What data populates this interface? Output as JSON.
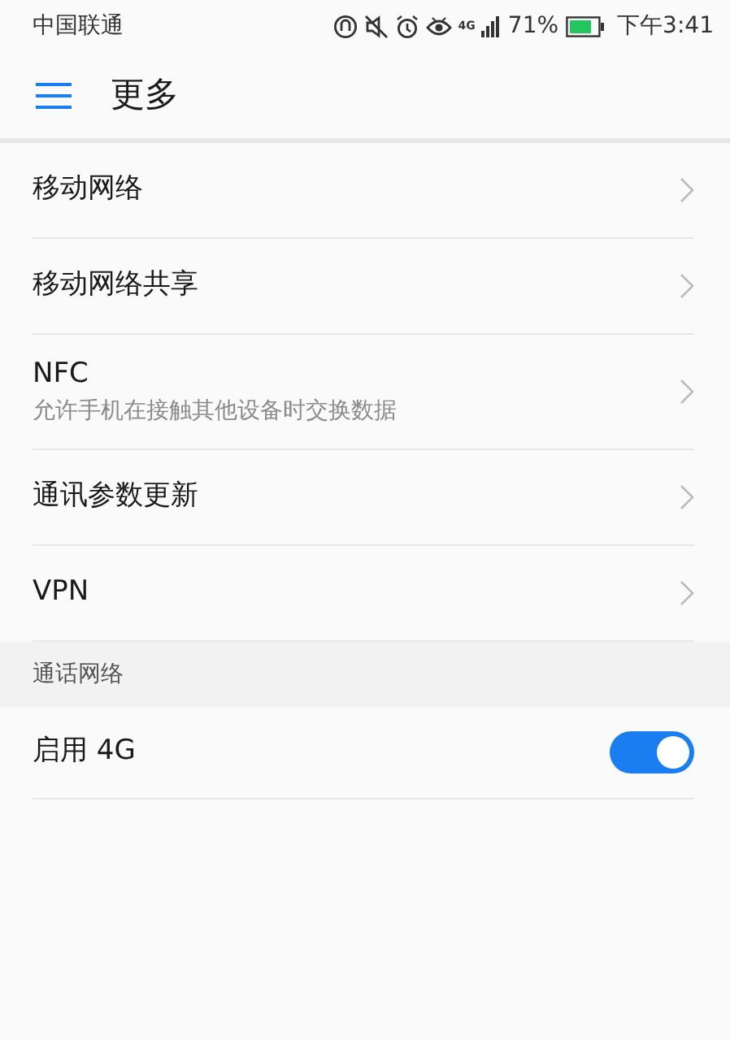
{
  "status_bar": {
    "carrier": "中国联通",
    "network_type": "4G",
    "battery_percent": "71%",
    "time": "下午3:41"
  },
  "app_bar": {
    "title": "更多"
  },
  "items": [
    {
      "kind": "link",
      "title": "移动网络"
    },
    {
      "kind": "link",
      "title": "移动网络共享"
    },
    {
      "kind": "link",
      "title": "NFC",
      "subtitle": "允许手机在接触其他设备时交换数据"
    },
    {
      "kind": "link",
      "title": "通讯参数更新"
    },
    {
      "kind": "link",
      "title": "VPN"
    },
    {
      "kind": "header",
      "title": "通话网络"
    },
    {
      "kind": "switch",
      "title": "启用 4G",
      "on": true
    }
  ]
}
